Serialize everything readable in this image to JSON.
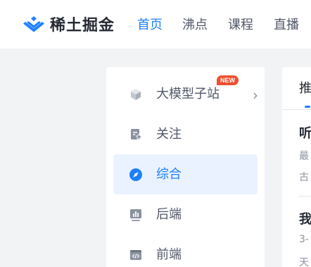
{
  "header": {
    "brand": "稀土掘金",
    "nav": [
      "首页",
      "沸点",
      "课程",
      "直播"
    ],
    "active_nav": "首页"
  },
  "sidebar": {
    "items": [
      {
        "label": "大模型子站",
        "icon": "cube-icon",
        "badge": "NEW",
        "chevron": "›"
      },
      {
        "label": "关注",
        "icon": "follow-star-icon"
      },
      {
        "label": "综合",
        "icon": "compass-icon",
        "active": true
      },
      {
        "label": "后端",
        "icon": "backend-chart-icon"
      },
      {
        "label": "前端",
        "icon": "frontend-code-icon"
      }
    ]
  },
  "feed": {
    "tab": "推",
    "articles": [
      {
        "title": "听",
        "line1": "最",
        "line2": "古"
      },
      {
        "title": "我",
        "line1": "3-",
        "line2": "天"
      }
    ]
  },
  "colors": {
    "accent": "#1e80ff",
    "badge": "#ee502f",
    "text": "#252933",
    "muted": "#515767",
    "background": "#f2f3f5"
  }
}
